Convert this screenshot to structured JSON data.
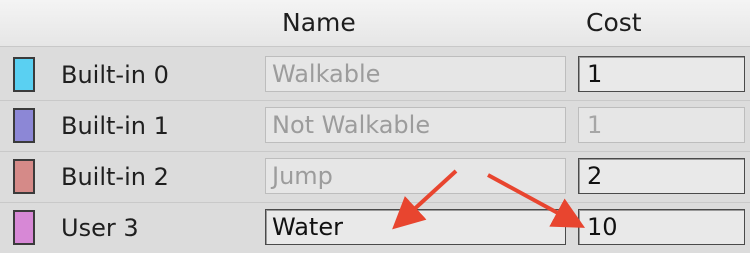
{
  "header": {
    "name_label": "Name",
    "cost_label": "Cost"
  },
  "rows": [
    {
      "label": "Built-in 0",
      "name": "Walkable",
      "cost": "1",
      "color": "#5ad0f2",
      "name_enabled": false,
      "cost_enabled": true
    },
    {
      "label": "Built-in 1",
      "name": "Not Walkable",
      "cost": "1",
      "color": "#8c87d6",
      "name_enabled": false,
      "cost_enabled": false
    },
    {
      "label": "Built-in 2",
      "name": "Jump",
      "cost": "2",
      "color": "#d58a88",
      "name_enabled": false,
      "cost_enabled": true
    },
    {
      "label": "User 3",
      "name": "Water",
      "cost": "10",
      "color": "#d788d6",
      "name_enabled": true,
      "cost_enabled": true
    }
  ],
  "annotation": {
    "arrow_color": "#e8452f"
  }
}
